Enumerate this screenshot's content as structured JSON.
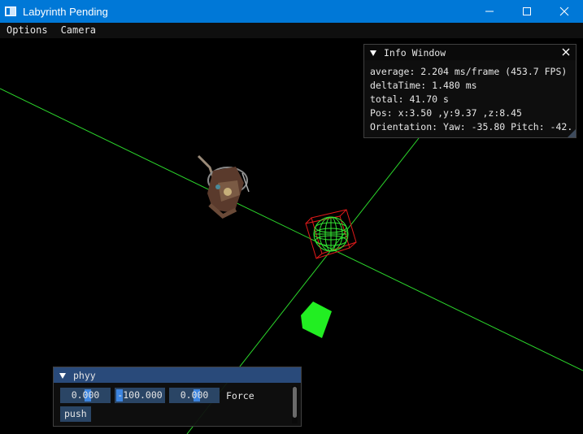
{
  "window": {
    "title": "Labyrinth Pending",
    "controls": [
      "minimize-icon",
      "maximize-icon",
      "close-icon"
    ]
  },
  "menubar": {
    "items": [
      {
        "label": "Options"
      },
      {
        "label": "Camera"
      }
    ]
  },
  "info_window": {
    "title": "Info Window",
    "lines": [
      "average: 2.204 ms/frame (453.7 FPS)",
      "deltaTime: 1.480 ms",
      "total: 41.70 s",
      "Pos: x:3.50 ,y:9.37 ,z:8.45",
      "Orientation: Yaw: -35.80 Pitch: -42."
    ]
  },
  "phyy_window": {
    "title": "phyy",
    "fields": [
      {
        "value": "0.000"
      },
      {
        "value": "-100.000"
      },
      {
        "value": "0.000"
      }
    ],
    "field_label": "Force",
    "button_label": "push"
  },
  "scene": {
    "axis_color": "#2bd62b",
    "bounding_box_color": "#e01a1a",
    "wire_sphere_color": "#33e633",
    "cube_color": "#22ee22",
    "objects": [
      "green-axis-line",
      "wireframe-sphere",
      "red-bounding-box",
      "green-cube",
      "character-model"
    ]
  }
}
